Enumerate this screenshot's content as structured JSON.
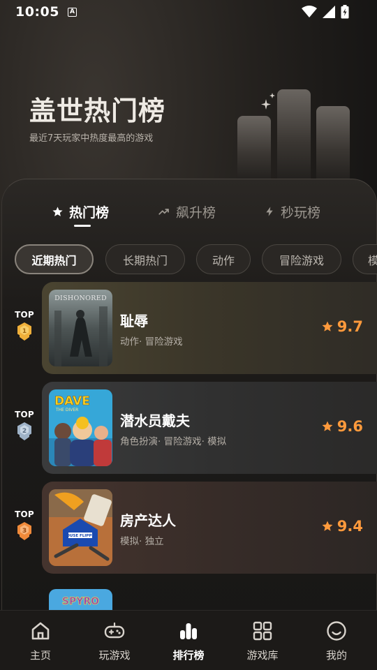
{
  "status": {
    "time": "10:05",
    "a_icon": "A"
  },
  "hero": {
    "title": "盖世热门榜",
    "subtitle": "最近7天玩家中热度最高的游戏"
  },
  "tabs": [
    {
      "label": "热门榜",
      "icon": "star-icon",
      "active": true
    },
    {
      "label": "飙升榜",
      "icon": "trending-up-icon",
      "active": false
    },
    {
      "label": "秒玩榜",
      "icon": "lightning-icon",
      "active": false
    }
  ],
  "chips": [
    {
      "label": "近期热门",
      "active": true
    },
    {
      "label": "长期热门",
      "active": false
    },
    {
      "label": "动作",
      "active": false
    },
    {
      "label": "冒险游戏",
      "active": false
    },
    {
      "label": "模",
      "active": false
    }
  ],
  "games": [
    {
      "rank_label": "TOP",
      "rank": "1",
      "name": "耻辱",
      "tags": "动作· 冒险游戏",
      "rating": "9.7",
      "cover_text": "DISHONORED"
    },
    {
      "rank_label": "TOP",
      "rank": "2",
      "name": "潜水员戴夫",
      "tags": "角色扮演· 冒险游戏· 模拟",
      "rating": "9.6",
      "cover_text": "DAVE",
      "cover_sub": "THE DIVER"
    },
    {
      "rank_label": "TOP",
      "rank": "3",
      "name": "房产达人",
      "tags": "模拟· 独立",
      "rating": "9.4",
      "cover_text": "HOUSE FLIPPER"
    },
    {
      "cover_text": "SPYRO"
    }
  ],
  "nav": [
    {
      "label": "主页",
      "icon": "home-icon",
      "active": false
    },
    {
      "label": "玩游戏",
      "icon": "gamepad-icon",
      "active": false
    },
    {
      "label": "排行榜",
      "icon": "ranking-icon",
      "active": true
    },
    {
      "label": "游戏库",
      "icon": "grid-icon",
      "active": false
    },
    {
      "label": "我的",
      "icon": "profile-icon",
      "active": false
    }
  ],
  "colors": {
    "accent": "#ff9a3c",
    "gold": "#f0b03a",
    "silver": "#9fb3c8",
    "bronze": "#f08a3a"
  }
}
